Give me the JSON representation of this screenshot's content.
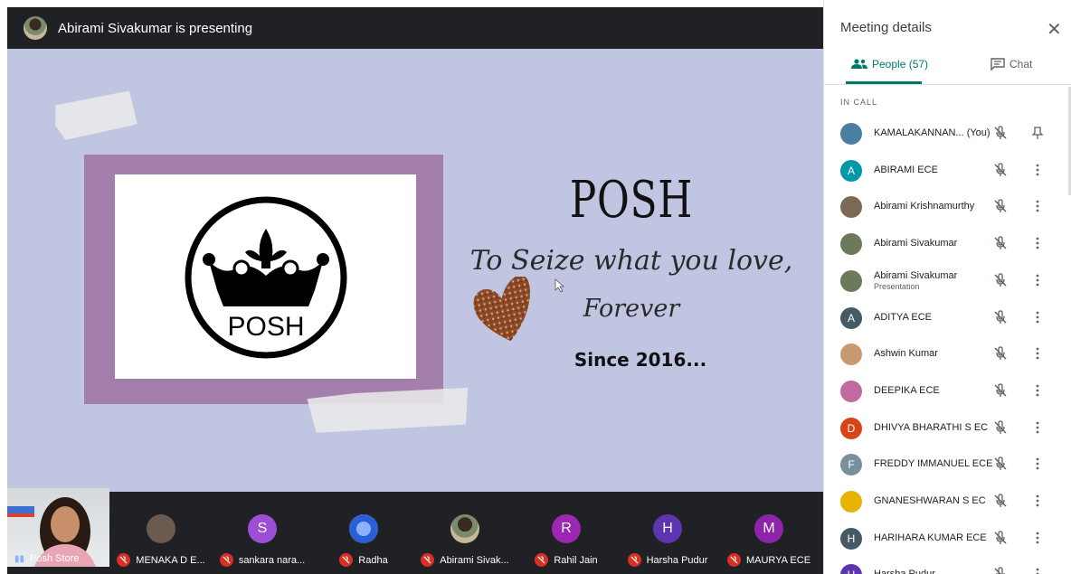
{
  "header": {
    "presenting_text": "Abirami Sivakumar is presenting",
    "presenter_avatar_icon": "user-photo"
  },
  "slide": {
    "logo_text": "POSH",
    "heading": "POSH",
    "tagline": "To Seize what you love,",
    "tagline2": "Forever",
    "since": "Since 2016...",
    "colors": {
      "background": "#c0c5e2",
      "frame": "#a57fab"
    }
  },
  "bottom_strip": {
    "self": {
      "name": "Posh Store"
    },
    "participants": [
      {
        "name": "MENAKA D E...",
        "avatar_letter": "",
        "avatar_color": "#6b5a50",
        "muted": true
      },
      {
        "name": "sankara nara...",
        "avatar_letter": "S",
        "avatar_color": "#9c4fd6",
        "muted": true
      },
      {
        "name": "Radha",
        "avatar_letter": "",
        "avatar_color": "#2a5fd8",
        "muted": true
      },
      {
        "name": "Abirami Sivak...",
        "avatar_letter": "",
        "avatar_color": "#6d7a5a",
        "muted": true
      },
      {
        "name": "Rahil Jain",
        "avatar_letter": "R",
        "avatar_color": "#9c27b0",
        "muted": true
      },
      {
        "name": "Harsha Pudur",
        "avatar_letter": "H",
        "avatar_color": "#5e35b1",
        "muted": true
      },
      {
        "name": "MAURYA ECE",
        "avatar_letter": "M",
        "avatar_color": "#8e24aa",
        "muted": true
      }
    ]
  },
  "panel": {
    "title": "Meeting details",
    "close_icon": "close-icon",
    "tabs": {
      "people": "People (57)",
      "chat": "Chat"
    },
    "section": "IN CALL",
    "people": [
      {
        "name": "KAMALAKANNAN... (You)",
        "sub": "",
        "letter": "",
        "color": "#4a7fa0",
        "action": "pin"
      },
      {
        "name": "ABIRAMI ECE",
        "sub": "",
        "letter": "A",
        "color": "#0097a7",
        "action": "more"
      },
      {
        "name": "Abirami Krishnamurthy",
        "sub": "",
        "letter": "",
        "color": "#7a6a55",
        "action": "more"
      },
      {
        "name": "Abirami Sivakumar",
        "sub": "",
        "letter": "",
        "color": "#6d7a5a",
        "action": "more"
      },
      {
        "name": "Abirami Sivakumar",
        "sub": "Presentation",
        "letter": "",
        "color": "#6d7a5a",
        "action": "more"
      },
      {
        "name": "ADITYA ECE",
        "sub": "",
        "letter": "A",
        "color": "#455a64",
        "action": "more"
      },
      {
        "name": "Ashwin Kumar",
        "sub": "",
        "letter": "",
        "color": "#c89a70",
        "action": "more"
      },
      {
        "name": "DEEPIKA ECE",
        "sub": "",
        "letter": "",
        "color": "#c06aa0",
        "action": "more"
      },
      {
        "name": "DHIVYA BHARATHI S EC",
        "sub": "",
        "letter": "D",
        "color": "#d84315",
        "action": "more"
      },
      {
        "name": "FREDDY IMMANUEL ECE",
        "sub": "",
        "letter": "F",
        "color": "#78909c",
        "action": "more"
      },
      {
        "name": "GNANESHWARAN S EC",
        "sub": "",
        "letter": "",
        "color": "#e6b400",
        "action": "more"
      },
      {
        "name": "HARIHARA KUMAR ECE",
        "sub": "",
        "letter": "H",
        "color": "#455a64",
        "action": "more"
      },
      {
        "name": "Harsha Pudur",
        "sub": "",
        "letter": "H",
        "color": "#5e35b1",
        "action": "more"
      }
    ]
  }
}
